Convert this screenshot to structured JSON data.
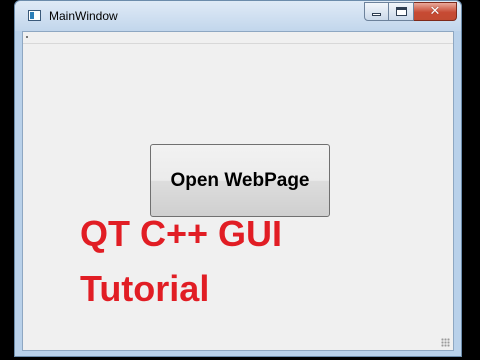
{
  "window": {
    "title": "MainWindow",
    "icon": "app-window-icon",
    "controls": {
      "minimize": "minimize-icon",
      "maximize": "maximize-icon",
      "close": "✕"
    },
    "accent_close": "#c74a33"
  },
  "main": {
    "button_label": "Open WebPage"
  },
  "overlay": {
    "line1": "QT C++ GUI",
    "line2": "Tutorial",
    "color": "#e11d24"
  }
}
